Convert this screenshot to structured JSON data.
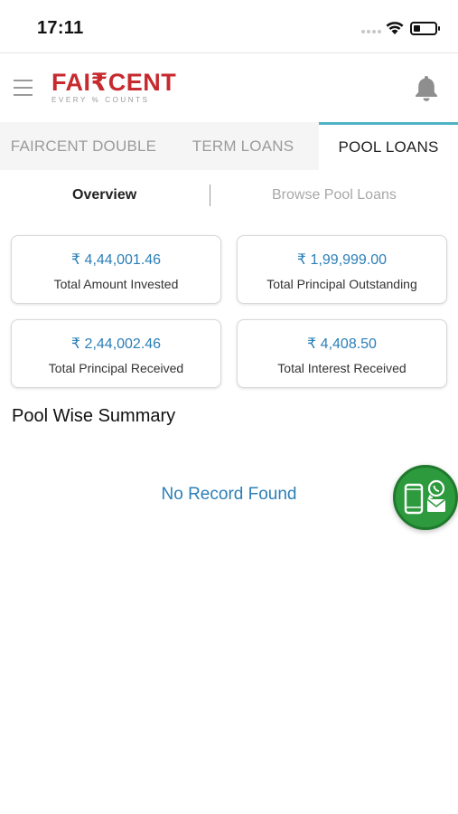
{
  "status_bar": {
    "time": "17:11"
  },
  "header": {
    "logo_main": "FAI₹CENT",
    "logo_tagline": "EVERY % COUNTS",
    "brand_color": "#c62a2f"
  },
  "tabs": [
    {
      "label": "FAIRCENT DOUBLE",
      "active": false
    },
    {
      "label": "TERM LOANS",
      "active": false
    },
    {
      "label": "POOL LOANS",
      "active": true
    }
  ],
  "subtabs": {
    "overview": "Overview",
    "browse": "Browse Pool Loans"
  },
  "cards": [
    {
      "amount": "₹ 4,44,001.46",
      "label": "Total Amount Invested"
    },
    {
      "amount": "₹ 1,99,999.00",
      "label": "Total Principal Outstanding"
    },
    {
      "amount": "₹ 2,44,002.46",
      "label": "Total Principal Received"
    },
    {
      "amount": "₹ 4,408.50",
      "label": "Total Interest Received"
    }
  ],
  "summary": {
    "title": "Pool Wise Summary",
    "empty_message": "No Record Found"
  },
  "colors": {
    "accent": "#2b7fb8",
    "tab_indicator": "#4fb3c6",
    "fab_green": "#2e9a3e"
  },
  "icons": {
    "menu": "hamburger-icon",
    "notifications": "bell-icon",
    "contact": "whatsapp-mail-icon"
  }
}
